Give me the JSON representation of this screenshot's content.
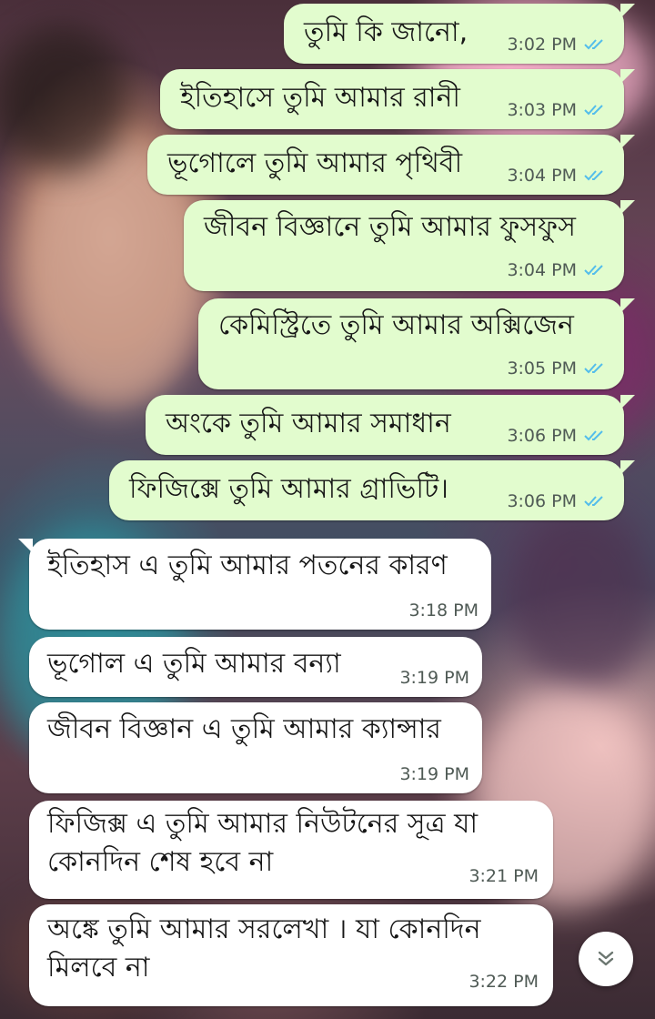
{
  "conversation": {
    "messages": [
      {
        "direction": "sent",
        "text": "তুমি কি জানো,",
        "time": "3:02 PM",
        "status": "read"
      },
      {
        "direction": "sent",
        "text": "ইতিহাসে তুমি আমার রানী",
        "time": "3:03 PM",
        "status": "read"
      },
      {
        "direction": "sent",
        "text": "ভূগোলে তুমি আমার পৃথিবী",
        "time": "3:04 PM",
        "status": "read"
      },
      {
        "direction": "sent",
        "text": "জীবন বিজ্ঞানে তুমি আমার ফুসফুস",
        "time": "3:04 PM",
        "status": "read"
      },
      {
        "direction": "sent",
        "text": "কেমিস্ট্রিতে তুমি আমার অক্সিজেন",
        "time": "3:05 PM",
        "status": "read"
      },
      {
        "direction": "sent",
        "text": "অংকে তুমি আমার সমাধান",
        "time": "3:06 PM",
        "status": "read"
      },
      {
        "direction": "sent",
        "text": "ফিজিক্সে তুমি আমার গ্রাভিটি।",
        "time": "3:06 PM",
        "status": "read"
      },
      {
        "direction": "received",
        "text": "ইতিহাস এ তুমি আমার পতনের কারণ",
        "time": "3:18 PM"
      },
      {
        "direction": "received",
        "text": "ভূগোল এ তুমি আমার বন্যা",
        "time": "3:19 PM"
      },
      {
        "direction": "received",
        "text": "জীবন বিজ্ঞান এ তুমি আমার ক্যান্সার",
        "time": "3:19 PM"
      },
      {
        "direction": "received",
        "text_line1": "ফিজিক্স এ তুমি আমার নিউটনের সূত্র যা",
        "text_line2": "কোনদিন শেষ হবে না",
        "time": "3:21 PM"
      },
      {
        "direction": "received",
        "text_line1": "অঙ্কে তুমি আমার সরলেখা । যা কোনদিন",
        "text_line2": "মিলবে না",
        "time": "3:22 PM"
      }
    ]
  },
  "icons": {
    "read_receipt": "double-check-icon",
    "scroll_down": "double-chevron-down-icon"
  },
  "colors": {
    "sent_bubble": "#e2fcce",
    "received_bubble": "#ffffff",
    "read_tick": "#53bdeb",
    "meta_text": "#4f5a55"
  }
}
